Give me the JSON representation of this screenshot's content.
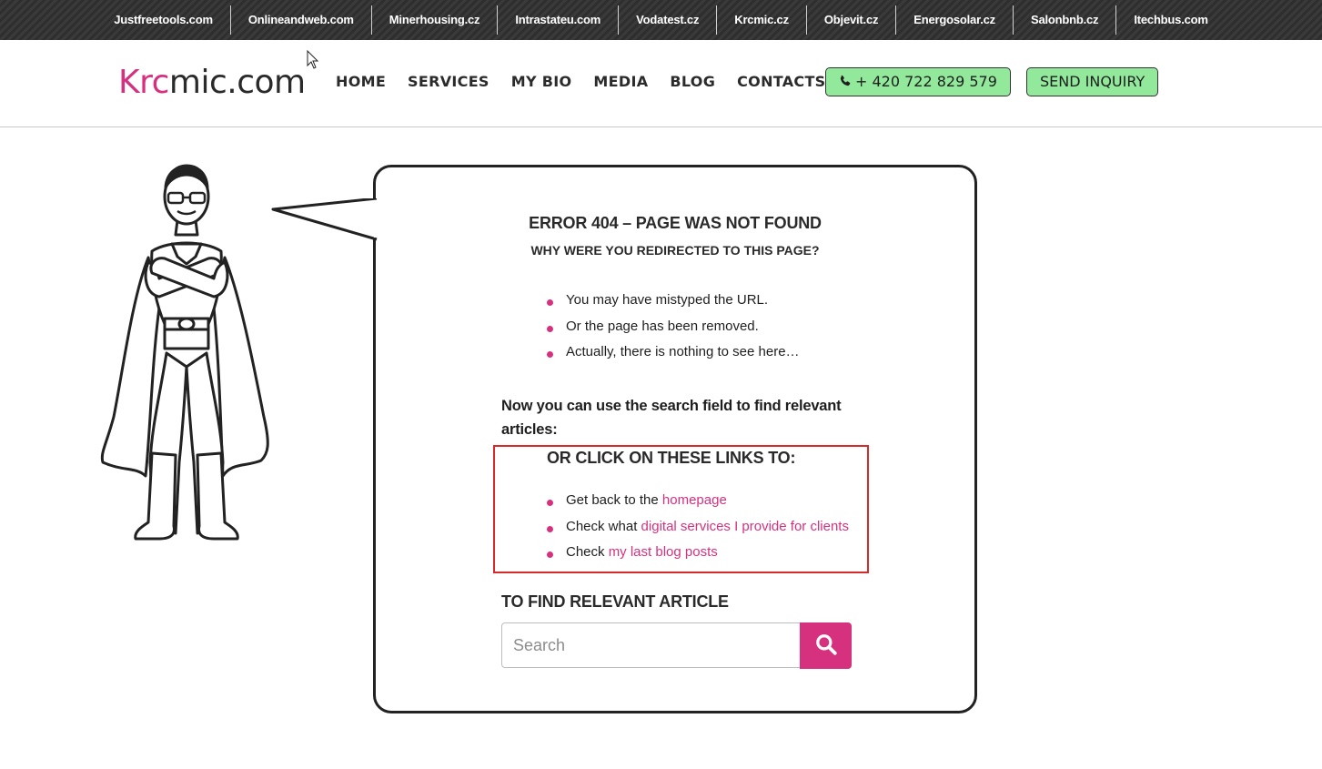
{
  "topbar": {
    "links": [
      "Justfreetools.com",
      "Onlineandweb.com",
      "Minerhousing.cz",
      "Intrastateu.com",
      "Vodatest.cz",
      "Krcmic.cz",
      "Objevit.cz",
      "Energosolar.cz",
      "Salonbnb.cz",
      "Itechbus.com"
    ]
  },
  "header": {
    "logo_accent": "Krc",
    "logo_rest": "mic.com",
    "nav": [
      "HOME",
      "SERVICES",
      "MY BIO",
      "MEDIA",
      "BLOG",
      "CONTACTS"
    ],
    "phone_label": "+ 420 722 829 579",
    "phone_icon": "phone-icon",
    "inquiry_label": "SEND INQUIRY"
  },
  "error": {
    "title": "ERROR 404 – PAGE WAS NOT FOUND",
    "subtitle": "WHY WERE YOU REDIRECTED TO THIS PAGE?",
    "reasons": [
      "You may have mistyped the URL.",
      "Or the page has been removed.",
      "Actually, there is nothing to see here…"
    ],
    "search_note": "Now you can use the search field to find relevant articles:",
    "links_title": "OR CLICK ON THESE LINKS TO:",
    "links": [
      {
        "prefix": "Get back to the ",
        "link": "homepage"
      },
      {
        "prefix": "Check what ",
        "link": "digital services I provide for clients"
      },
      {
        "prefix": "Check ",
        "link": "my last blog posts"
      }
    ],
    "find_title": "TO FIND RELEVANT ARTICLE",
    "search_placeholder": "Search",
    "search_icon": "search-icon"
  },
  "colors": {
    "accent": "#d6317f",
    "button_green": "#92e89b",
    "highlight_border": "#d72a2a"
  }
}
